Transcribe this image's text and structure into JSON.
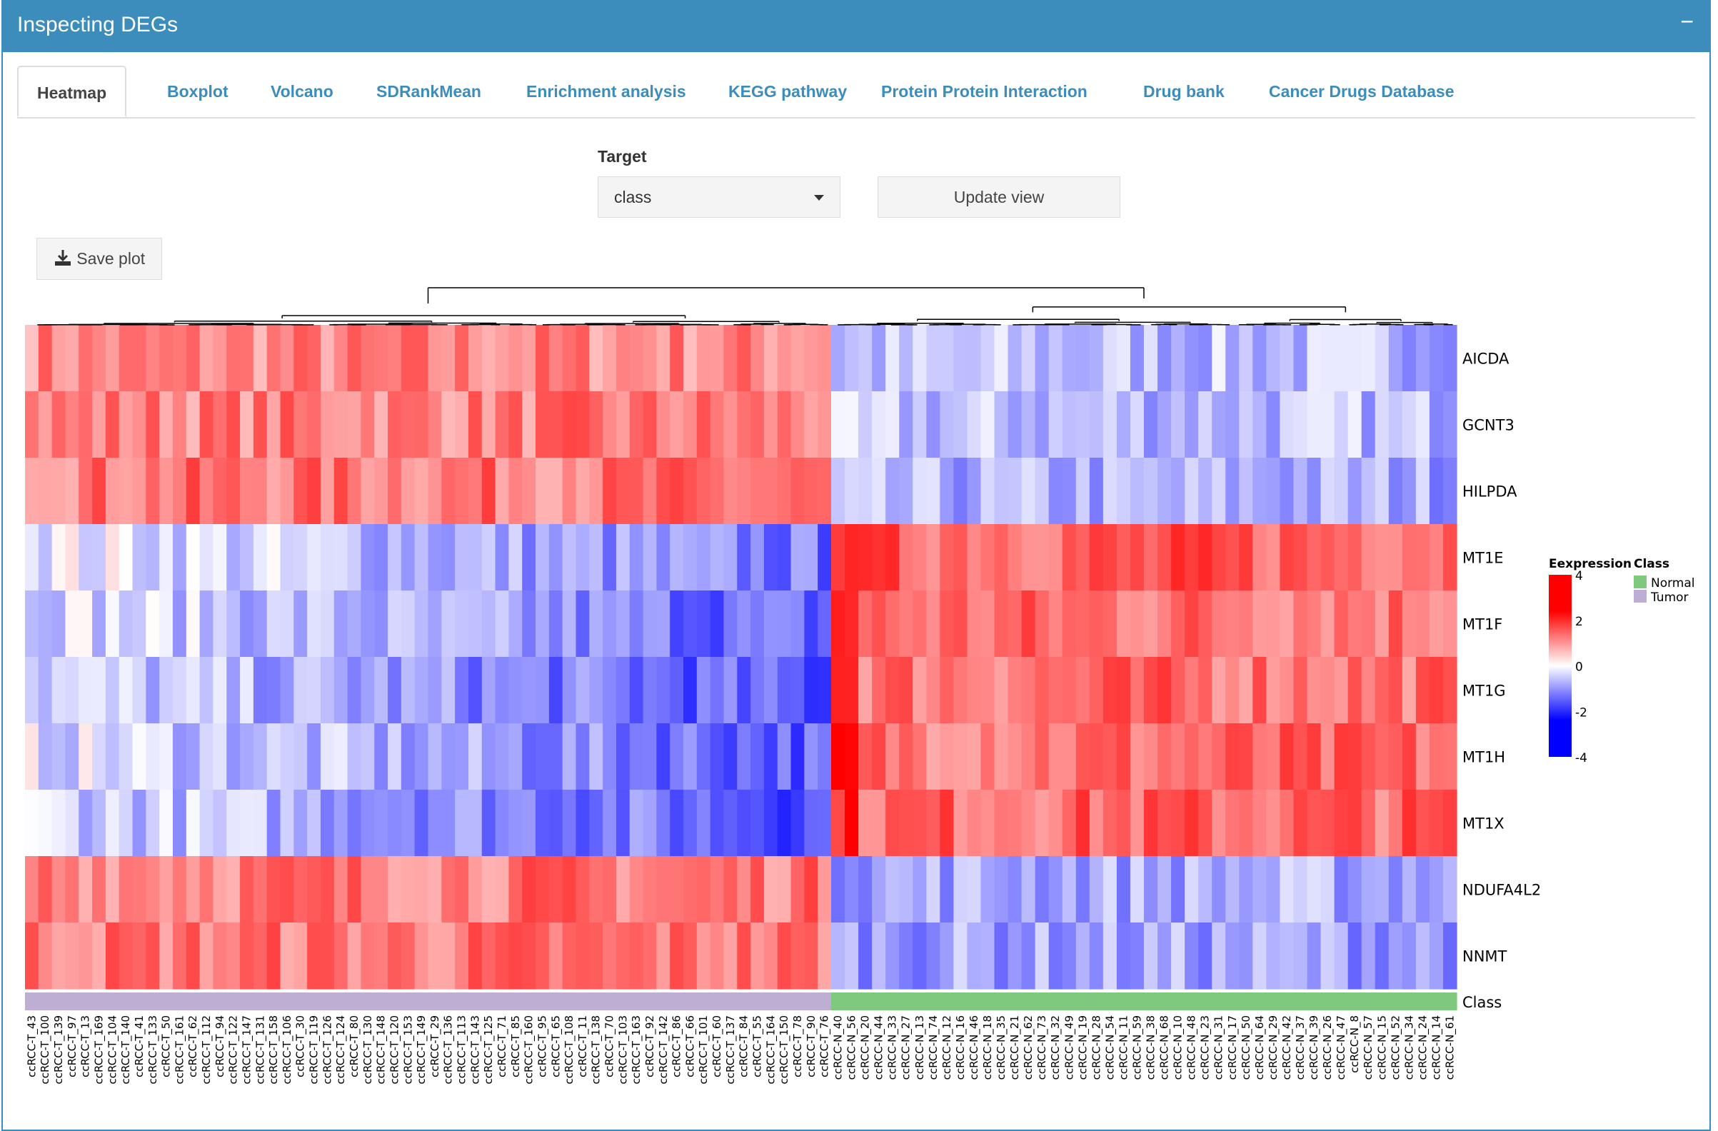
{
  "header": {
    "title": "Inspecting DEGs",
    "collapse_label": "−"
  },
  "tabs": [
    {
      "label": "Heatmap",
      "active": true
    },
    {
      "label": "Boxplot"
    },
    {
      "label": "Volcano"
    },
    {
      "label": "SDRankMean"
    },
    {
      "label": "Enrichment analysis"
    },
    {
      "label": "KEGG pathway"
    },
    {
      "label": "Protein Protein Interaction"
    },
    {
      "label": "Drug bank"
    },
    {
      "label": "Cancer Drugs Database"
    }
  ],
  "controls": {
    "target_label": "Target",
    "target_value": "class",
    "update_label": "Update view",
    "save_label": "Save plot"
  },
  "chart_data": {
    "type": "heatmap",
    "genes": [
      "AICDA",
      "GCNT3",
      "HILPDA",
      "MT1E",
      "MT1F",
      "MT1G",
      "MT1H",
      "MT1X",
      "NDUFA4L2",
      "NNMT"
    ],
    "groups": [
      {
        "name": "Tumor",
        "color": "#beaed4",
        "row_means": [
          1.4,
          1.5,
          1.6,
          -0.7,
          -0.9,
          -1.1,
          -0.9,
          -1.0,
          1.6,
          1.6
        ]
      },
      {
        "name": "Normal",
        "color": "#7fc97f",
        "row_means": [
          -0.8,
          -0.8,
          -1.0,
          1.9,
          1.7,
          1.7,
          1.7,
          1.8,
          -1.0,
          -1.1
        ]
      }
    ],
    "annotation_label": "Class",
    "colorbar": {
      "title": "Eexpression",
      "ticks": [
        4,
        2,
        0,
        -2,
        -4
      ],
      "low": "#0000ff",
      "mid": "#ffffff",
      "high": "#ff0000"
    },
    "class_legend": {
      "title": "Class",
      "entries": [
        {
          "label": "Normal",
          "color": "#7fc97f"
        },
        {
          "label": "Tumor",
          "color": "#beaed4"
        }
      ]
    },
    "column_labels": {
      "tumor": [
        "ccRCC-T_43",
        "ccRCC-T_100",
        "ccRCC-T_139",
        "ccRCC-T_97",
        "ccRCC-T_13",
        "ccRCC-T_169",
        "ccRCC-T_104",
        "ccRCC-T_140",
        "ccRCC-T_41",
        "ccRCC-T_133",
        "ccRCC-T_50",
        "ccRCC-T_161",
        "ccRCC-T_62",
        "ccRCC-T_112",
        "ccRCC-T_94",
        "ccRCC-T_122",
        "ccRCC-T_147",
        "ccRCC-T_131",
        "ccRCC-T_158",
        "ccRCC-T_106",
        "ccRCC-T_30",
        "ccRCC-T_119",
        "ccRCC-T_126",
        "ccRCC-T_124",
        "ccRCC-T_80",
        "ccRCC-T_130",
        "ccRCC-T_148",
        "ccRCC-T_120",
        "ccRCC-T_153",
        "ccRCC-T_149",
        "ccRCC-T_29",
        "ccRCC-T_136",
        "ccRCC-T_113",
        "ccRCC-T_143",
        "ccRCC-T_125",
        "ccRCC-T_71",
        "ccRCC-T_85",
        "ccRCC-T_160",
        "ccRCC-T_95",
        "ccRCC-T_65",
        "ccRCC-T_108",
        "ccRCC-T_11",
        "ccRCC-T_138",
        "ccRCC-T_70",
        "ccRCC-T_103",
        "ccRCC-T_163",
        "ccRCC-T_92",
        "ccRCC-T_142",
        "ccRCC-T_86",
        "ccRCC-T_66",
        "ccRCC-T_101",
        "ccRCC-T_60",
        "ccRCC-T_137",
        "ccRCC-T_84",
        "ccRCC-T_55",
        "ccRCC-T_164",
        "ccRCC-T_150",
        "ccRCC-T_78",
        "ccRCC-T_90",
        "ccRCC-T_76"
      ],
      "normal": [
        "ccRCC-N_40",
        "ccRCC-N_56",
        "ccRCC-N_20",
        "ccRCC-N_44",
        "ccRCC-N_33",
        "ccRCC-N_27",
        "ccRCC-N_13",
        "ccRCC-N_74",
        "ccRCC-N_12",
        "ccRCC-N_16",
        "ccRCC-N_46",
        "ccRCC-N_18",
        "ccRCC-N_35",
        "ccRCC-N_21",
        "ccRCC-N_62",
        "ccRCC-N_73",
        "ccRCC-N_32",
        "ccRCC-N_49",
        "ccRCC-N_19",
        "ccRCC-N_28",
        "ccRCC-N_54",
        "ccRCC-N_11",
        "ccRCC-N_59",
        "ccRCC-N_38",
        "ccRCC-N_68",
        "ccRCC-N_10",
        "ccRCC-N_48",
        "ccRCC-N_23",
        "ccRCC-N_31",
        "ccRCC-N_17",
        "ccRCC-N_50",
        "ccRCC-N_64",
        "ccRCC-N_29",
        "ccRCC-N_42",
        "ccRCC-N_37",
        "ccRCC-N_39",
        "ccRCC-N_26",
        "ccRCC-N_47",
        "ccRCC-N_8",
        "ccRCC-N_57",
        "ccRCC-N_15",
        "ccRCC-N_52",
        "ccRCC-N_34",
        "ccRCC-N_24",
        "ccRCC-N_14",
        "ccRCC-N_61"
      ]
    }
  }
}
